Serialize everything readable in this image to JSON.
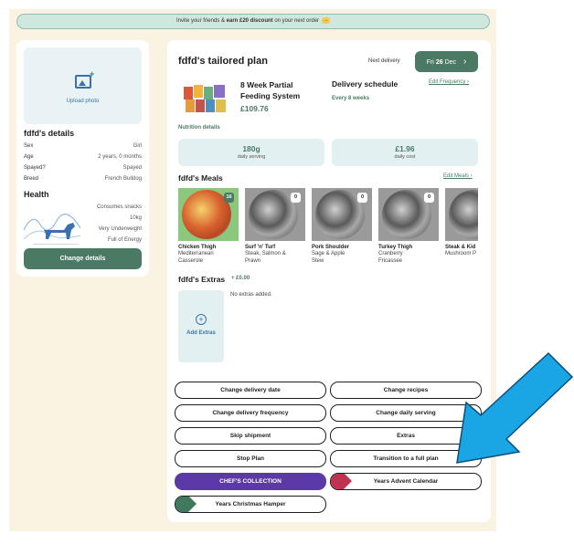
{
  "banner": {
    "prefix": "Invite your friends & ",
    "bold": "earn £20 discount",
    "suffix": " on your next order",
    "arrow": "→"
  },
  "left": {
    "upload_label": "Upload photo",
    "details_title": "fdfd's details",
    "details": [
      {
        "label": "Sex",
        "value": "Girl"
      },
      {
        "label": "Age",
        "value": "2 years, 0 months"
      },
      {
        "label": "Spayed?",
        "value": "Spayed"
      },
      {
        "label": "Breed",
        "value": "French Bulldog"
      }
    ],
    "health_title": "Health",
    "health": [
      "Consumes snacks",
      "10kg",
      "Very Underweight",
      "Full of Energy"
    ],
    "change_details": "Change details"
  },
  "plan": {
    "title": "fdfd's tailored plan",
    "next_delivery_label": "Next delivery",
    "delivery_day": "Fri",
    "delivery_date": "26",
    "delivery_month": "Dec",
    "delivery_chevron": "›",
    "product_name": "8 Week Partial Feeding System",
    "product_price": "£109.76",
    "schedule_title": "Delivery schedule",
    "schedule_value": "Every 8 weeks",
    "edit_frequency": "Edit Frequency ›",
    "nutrition_label": "Nutrition details",
    "stats": [
      {
        "value": "180g",
        "label": "daily serving"
      },
      {
        "value": "£1.96",
        "label": "daily cost"
      }
    ]
  },
  "meals": {
    "title": "fdfd's Meals",
    "edit": "Edit Meals ›",
    "items": [
      {
        "name": "Chicken Thigh",
        "desc1": "Mediterranean",
        "desc2": "Casserole",
        "count": "16"
      },
      {
        "name": "Surf 'n' Turf",
        "desc1": "Steak, Salmon &",
        "desc2": "Prawn",
        "count": "0"
      },
      {
        "name": "Pork Shoulder",
        "desc1": "Sage & Apple",
        "desc2": "Stew",
        "count": "0"
      },
      {
        "name": "Turkey Thigh",
        "desc1": "Cranberry",
        "desc2": "Fricassee",
        "count": "0"
      },
      {
        "name": "Steak & Kid",
        "desc1": "Mushroom P",
        "desc2": "",
        "count": ""
      }
    ]
  },
  "extras": {
    "title": "fdfd's Extras",
    "price": "+ £0.00",
    "add": "Add Extras",
    "plus": "+",
    "empty": "No extras added."
  },
  "actions": {
    "change_delivery_date": "Change delivery date",
    "change_recipes": "Change recipes",
    "change_delivery_frequency": "Change delivery frequency",
    "change_daily_serving": "Change daily serving",
    "skip_shipment": "Skip shipment",
    "extras": "Extras",
    "stop_plan": "Stop Plan",
    "transition": "Transition to a full plan",
    "chefs_collection": "CHEF'S COLLECTION",
    "advent_calendar": "Years Advent Calendar",
    "christmas_hamper": "Years Christmas Hamper"
  },
  "colors": {
    "brand_green": "#4b7a64",
    "background": "#fbf3e2",
    "purple": "#5b3aa8",
    "pink": "#d63a5e",
    "pointer_blue": "#1aa6e4"
  }
}
